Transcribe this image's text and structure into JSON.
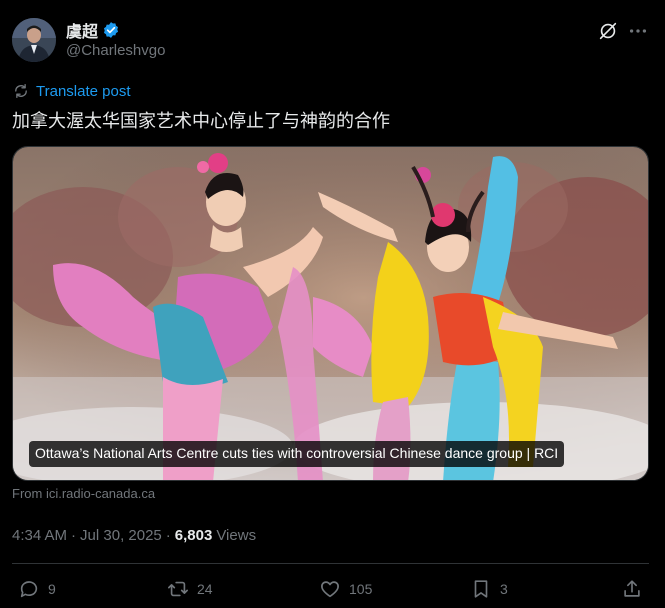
{
  "author": {
    "display_name": "虞超",
    "handle": "@Charleshvgo"
  },
  "icons": {
    "verified": "verified-badge-icon",
    "grok": "grok-icon",
    "more": "more-icon",
    "translate": "translate-icon",
    "reply": "reply-icon",
    "repost": "repost-icon",
    "like": "like-icon",
    "bookmark": "bookmark-icon",
    "share": "share-icon"
  },
  "translate_label": "Translate post",
  "post_text": "加拿大渥太华国家艺术中心停止了与神韵的合作",
  "media": {
    "caption": "Ottawa’s National Arts Centre cuts ties with controversial Chinese dance group | RCI",
    "source": "From ici.radio-canada.ca"
  },
  "meta": {
    "time": "4:34 AM",
    "separator": "·",
    "date": "Jul 30, 2025",
    "views_count": "6,803",
    "views_label": "Views"
  },
  "stats": {
    "replies": "9",
    "reposts": "24",
    "likes": "105",
    "bookmarks": "3"
  },
  "colors": {
    "background": "#000000",
    "text": "#e7e9ea",
    "muted": "#71767b",
    "accent": "#1d9bf0",
    "border": "#2f3336"
  }
}
